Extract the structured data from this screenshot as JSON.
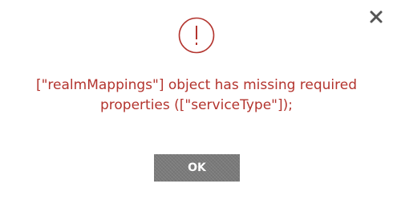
{
  "dialog": {
    "icon": "exclamation-circle-icon",
    "close_icon": "close-icon",
    "message": "[\"realmMappings\"] object has missing required\nproperties ([\"serviceType\"]);",
    "ok_label": "OK"
  },
  "colors": {
    "accent": "#b3342e",
    "button_bg": "#7a7a7a",
    "close_icon": "#555555",
    "background": "#ffffff"
  }
}
